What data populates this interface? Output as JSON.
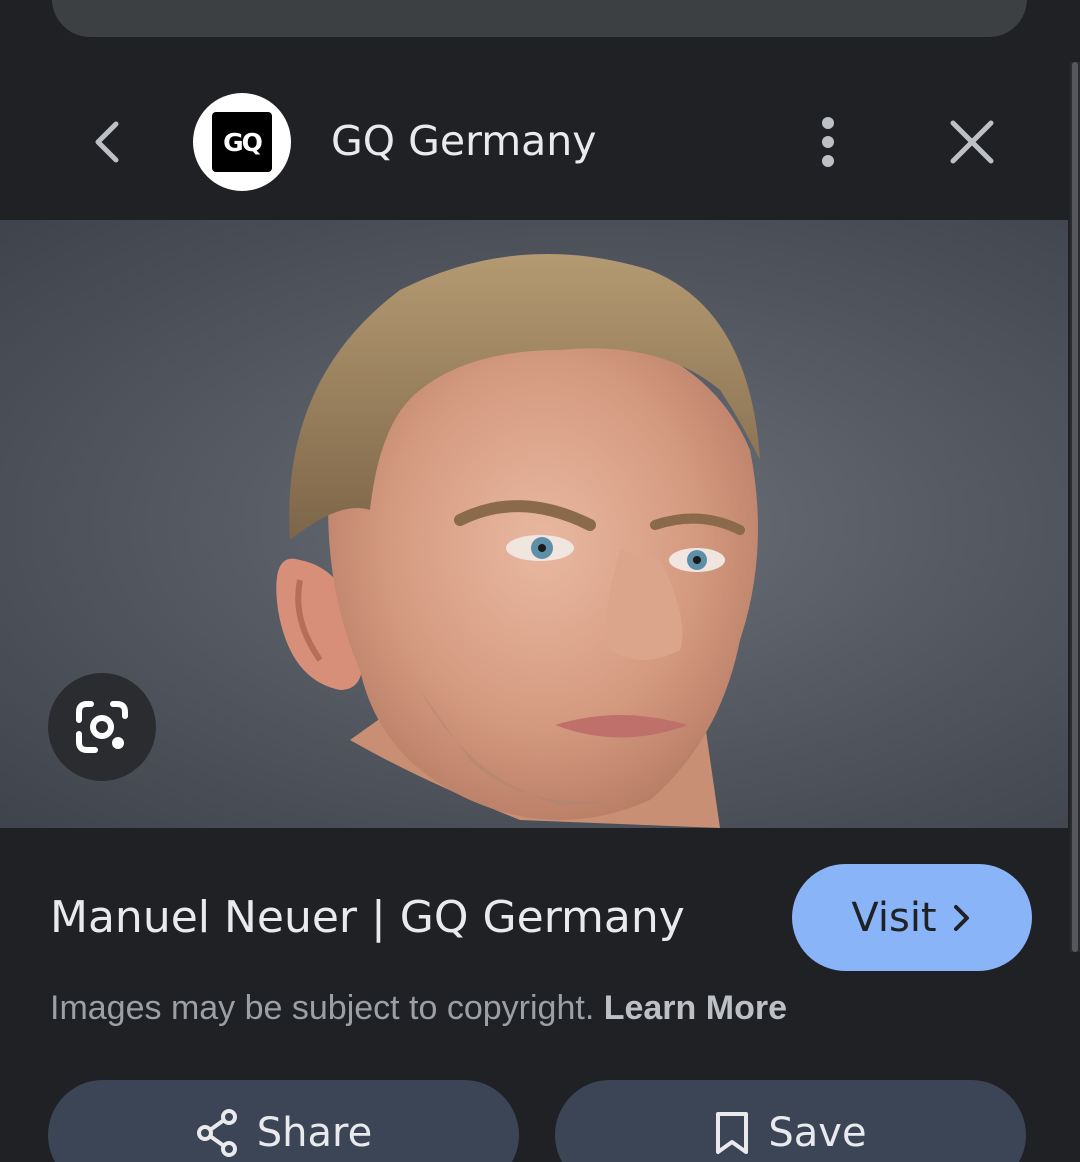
{
  "header": {
    "source_logo_text": "GQ",
    "source_name": "GQ Germany"
  },
  "icons": {
    "back": "chevron-left-icon",
    "more": "more-vert-icon",
    "close": "close-icon",
    "lens": "google-lens-icon",
    "visit": "chevron-right-icon",
    "share": "share-icon",
    "save": "bookmark-icon"
  },
  "image": {
    "alt": "Manuel Neuer portrait"
  },
  "result": {
    "title": "Manuel Neuer | GQ Germany",
    "visit_label": "Visit",
    "copyright_text": "Images may be subject to copyright. ",
    "learn_more": "Learn More"
  },
  "actions": {
    "share_label": "Share",
    "save_label": "Save"
  },
  "colors": {
    "background": "#202124",
    "visit_button": "#8ab4f8",
    "action_button": "#3c4556",
    "text_primary": "#e8eaed",
    "text_secondary": "#9aa0a6"
  }
}
